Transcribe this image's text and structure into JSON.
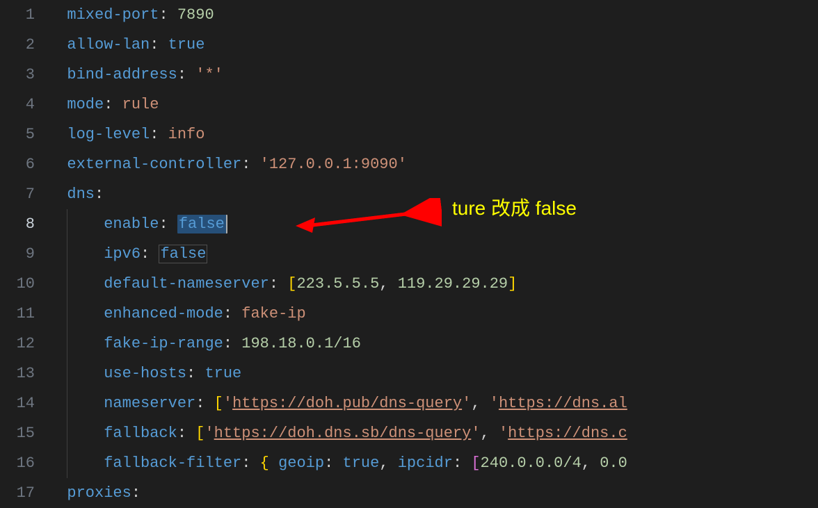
{
  "annotation": {
    "text": "ture 改成 false"
  },
  "lines": [
    {
      "num": "1",
      "indent": 0,
      "tokens": [
        {
          "t": "key",
          "v": "mixed-port"
        },
        {
          "t": "colon",
          "v": ": "
        },
        {
          "t": "number",
          "v": "7890"
        }
      ]
    },
    {
      "num": "2",
      "indent": 0,
      "tokens": [
        {
          "t": "key",
          "v": "allow-lan"
        },
        {
          "t": "colon",
          "v": ": "
        },
        {
          "t": "value-true",
          "v": "true"
        }
      ]
    },
    {
      "num": "3",
      "indent": 0,
      "tokens": [
        {
          "t": "key",
          "v": "bind-address"
        },
        {
          "t": "colon",
          "v": ": "
        },
        {
          "t": "string",
          "v": "'*'"
        }
      ]
    },
    {
      "num": "4",
      "indent": 0,
      "tokens": [
        {
          "t": "key",
          "v": "mode"
        },
        {
          "t": "colon",
          "v": ": "
        },
        {
          "t": "text-plain",
          "v": "rule"
        }
      ]
    },
    {
      "num": "5",
      "indent": 0,
      "tokens": [
        {
          "t": "key",
          "v": "log-level"
        },
        {
          "t": "colon",
          "v": ": "
        },
        {
          "t": "text-plain",
          "v": "info"
        }
      ]
    },
    {
      "num": "6",
      "indent": 0,
      "tokens": [
        {
          "t": "key",
          "v": "external-controller"
        },
        {
          "t": "colon",
          "v": ": "
        },
        {
          "t": "string",
          "v": "'127.0.0.1:9090'"
        }
      ]
    },
    {
      "num": "7",
      "indent": 0,
      "tokens": [
        {
          "t": "key",
          "v": "dns"
        },
        {
          "t": "colon",
          "v": ":"
        }
      ]
    },
    {
      "num": "8",
      "indent": 1,
      "active": true,
      "tokens": [
        {
          "t": "key",
          "v": "enable"
        },
        {
          "t": "colon",
          "v": ": "
        },
        {
          "t": "value-false",
          "v": "false",
          "selected": true,
          "cursor": true
        }
      ]
    },
    {
      "num": "9",
      "indent": 1,
      "tokens": [
        {
          "t": "key",
          "v": "ipv6"
        },
        {
          "t": "colon",
          "v": ": "
        },
        {
          "t": "value-false",
          "v": "false",
          "highlighted": true
        }
      ]
    },
    {
      "num": "10",
      "indent": 1,
      "tokens": [
        {
          "t": "key",
          "v": "default-nameserver"
        },
        {
          "t": "colon",
          "v": ": "
        },
        {
          "t": "bracket",
          "v": "["
        },
        {
          "t": "number",
          "v": "223.5.5.5"
        },
        {
          "t": "comma",
          "v": ", "
        },
        {
          "t": "number",
          "v": "119.29.29.29"
        },
        {
          "t": "bracket",
          "v": "]"
        }
      ]
    },
    {
      "num": "11",
      "indent": 1,
      "tokens": [
        {
          "t": "key",
          "v": "enhanced-mode"
        },
        {
          "t": "colon",
          "v": ": "
        },
        {
          "t": "text-plain",
          "v": "fake-ip"
        }
      ]
    },
    {
      "num": "12",
      "indent": 1,
      "tokens": [
        {
          "t": "key",
          "v": "fake-ip-range"
        },
        {
          "t": "colon",
          "v": ": "
        },
        {
          "t": "number",
          "v": "198.18.0.1/16"
        }
      ]
    },
    {
      "num": "13",
      "indent": 1,
      "tokens": [
        {
          "t": "key",
          "v": "use-hosts"
        },
        {
          "t": "colon",
          "v": ": "
        },
        {
          "t": "value-true",
          "v": "true"
        }
      ]
    },
    {
      "num": "14",
      "indent": 1,
      "tokens": [
        {
          "t": "key",
          "v": "nameserver"
        },
        {
          "t": "colon",
          "v": ": "
        },
        {
          "t": "bracket",
          "v": "["
        },
        {
          "t": "string",
          "v": "'"
        },
        {
          "t": "url",
          "v": "https://doh.pub/dns-query"
        },
        {
          "t": "string",
          "v": "'"
        },
        {
          "t": "comma",
          "v": ", "
        },
        {
          "t": "string",
          "v": "'"
        },
        {
          "t": "url",
          "v": "https://dns.al"
        }
      ]
    },
    {
      "num": "15",
      "indent": 1,
      "tokens": [
        {
          "t": "key",
          "v": "fallback"
        },
        {
          "t": "colon",
          "v": ": "
        },
        {
          "t": "bracket",
          "v": "["
        },
        {
          "t": "string",
          "v": "'"
        },
        {
          "t": "url",
          "v": "https://doh.dns.sb/dns-query"
        },
        {
          "t": "string",
          "v": "'"
        },
        {
          "t": "comma",
          "v": ", "
        },
        {
          "t": "string",
          "v": "'"
        },
        {
          "t": "url",
          "v": "https://dns.c"
        }
      ]
    },
    {
      "num": "16",
      "indent": 1,
      "tokens": [
        {
          "t": "key",
          "v": "fallback-filter"
        },
        {
          "t": "colon",
          "v": ": "
        },
        {
          "t": "bracket",
          "v": "{ "
        },
        {
          "t": "key",
          "v": "geoip"
        },
        {
          "t": "colon",
          "v": ": "
        },
        {
          "t": "value-true",
          "v": "true"
        },
        {
          "t": "comma",
          "v": ", "
        },
        {
          "t": "key",
          "v": "ipcidr"
        },
        {
          "t": "colon",
          "v": ": "
        },
        {
          "t": "bracket2",
          "v": "["
        },
        {
          "t": "number",
          "v": "240.0.0.0/4"
        },
        {
          "t": "comma",
          "v": ", "
        },
        {
          "t": "number",
          "v": "0.0"
        }
      ]
    },
    {
      "num": "17",
      "indent": 0,
      "tokens": [
        {
          "t": "key",
          "v": "proxies"
        },
        {
          "t": "colon",
          "v": ":"
        }
      ]
    }
  ]
}
